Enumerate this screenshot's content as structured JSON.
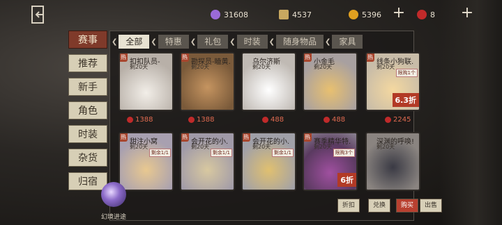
{
  "resources": {
    "purple": "31608",
    "puzzle": "4537",
    "coin": "5396",
    "red": "8"
  },
  "sidebar": {
    "items": [
      "赛事",
      "推荐",
      "新手",
      "角色",
      "时装",
      "杂货",
      "归宿"
    ]
  },
  "tabs": [
    "全部",
    "特惠",
    "礼包",
    "时装",
    "随身物品",
    "家具"
  ],
  "cards": [
    {
      "name": "扣扣队员-",
      "sub": "剩20天",
      "hot": "热",
      "price": "1388",
      "tag": "",
      "discount": ""
    },
    {
      "name": "勘探员-瞌黄.",
      "sub": "剩20天",
      "hot": "热",
      "price": "1388",
      "tag": "",
      "discount": ""
    },
    {
      "name": "乌尔济斯",
      "sub": "剩20天",
      "hot": "",
      "price": "488",
      "tag": "",
      "discount": ""
    },
    {
      "name": "小金毛",
      "sub": "剩20天",
      "hot": "热",
      "price": "488",
      "tag": "",
      "discount": ""
    },
    {
      "name": "线条小狗联.",
      "sub": "剩20天",
      "hot": "热",
      "price": "2245",
      "tag": "限购1个",
      "discount": "6.3折"
    },
    {
      "name": "甜注小窝",
      "sub": "剩20天",
      "hot": "热",
      "price": "",
      "tag": "剩余1/1",
      "discount": ""
    },
    {
      "name": "会开花的小.",
      "sub": "剩20天",
      "hot": "热",
      "price": "",
      "tag": "剩余1/1",
      "discount": ""
    },
    {
      "name": "会开花的小.",
      "sub": "剩20天",
      "hot": "热",
      "price": "",
      "tag": "剩余1/1",
      "discount": ""
    },
    {
      "name": "赛季精华特.",
      "sub": "剩20天",
      "hot": "热",
      "price": "",
      "tag": "限购3个",
      "discount": "6折"
    },
    {
      "name": "深渊的呼唤!",
      "sub": "剩20天",
      "hot": "",
      "price": "",
      "tag": "",
      "discount": ""
    }
  ],
  "bottom": {
    "orb_label": "幻境进途",
    "btn1": "折扣",
    "btn2": "兑换",
    "btn3": "购买",
    "btn4": "出售"
  },
  "colors": {
    "accent": "#7f3a2a",
    "panel": "#1c1a18",
    "card": "#d9d4cc"
  }
}
